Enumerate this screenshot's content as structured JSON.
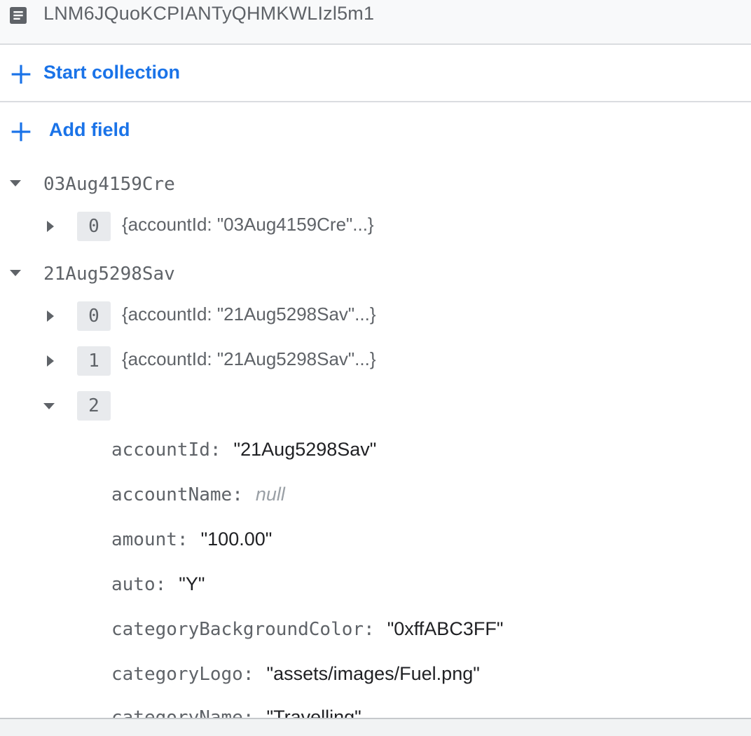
{
  "document": {
    "id": "LNM6JQuoKCPIANTyQHMKWLIzl5m1",
    "icon": "document-icon"
  },
  "actions": {
    "start_collection": "Start collection",
    "add_field": "Add field"
  },
  "tree": {
    "group1": {
      "key": "03Aug4159Cre",
      "items": [
        {
          "index": "0",
          "summary": "{accountId: \"03Aug4159Cre\"...}"
        }
      ]
    },
    "group2": {
      "key": "21Aug5298Sav",
      "items": [
        {
          "index": "0",
          "summary": "{accountId: \"21Aug5298Sav\"...}"
        },
        {
          "index": "1",
          "summary": "{accountId: \"21Aug5298Sav\"...}"
        },
        {
          "index": "2"
        }
      ]
    }
  },
  "fields": [
    {
      "key": "accountId",
      "value": "\"21Aug5298Sav\""
    },
    {
      "key": "accountName",
      "value": "null"
    },
    {
      "key": "amount",
      "value": "\"100.00\""
    },
    {
      "key": "auto",
      "value": "\"Y\""
    },
    {
      "key": "categoryBackgroundColor",
      "value": "\"0xffABC3FF\""
    },
    {
      "key": "categoryLogo",
      "value": "\"assets/images/Fuel.png\""
    },
    {
      "key": "categoryName",
      "value": "\"Travelling\""
    }
  ],
  "colors": {
    "accent": "#1a73e8",
    "key_text": "#5f6368",
    "value_text": "#202124",
    "null_text": "#9aa0a6"
  }
}
